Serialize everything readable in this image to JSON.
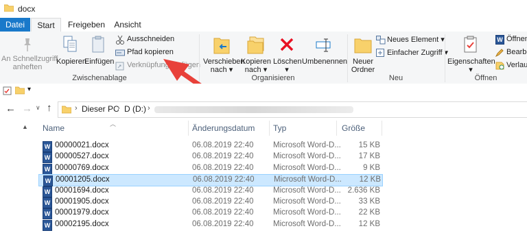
{
  "window": {
    "title": "docx"
  },
  "tabs": [
    "Datei",
    "Start",
    "Freigeben",
    "Ansicht"
  ],
  "ribbon": {
    "clipboard": {
      "pin_label": [
        "An Schnellzugriff",
        "anheften"
      ],
      "copy_label": "Kopieren",
      "paste_label": "Einfügen",
      "cut_label": "Ausschneiden",
      "copy_path_label": "Pfad kopieren",
      "paste_shortcut_label": "Verknüpfung einfügen",
      "group_label": "Zwischenablage"
    },
    "organize": {
      "move_label": [
        "Verschieben",
        "nach ▾"
      ],
      "copyto_label": [
        "Kopieren",
        "nach ▾"
      ],
      "delete_label": [
        "Löschen",
        "▾"
      ],
      "rename_label": "Umbenennen",
      "group_label": "Organisieren"
    },
    "new": {
      "new_folder_label": [
        "Neuer",
        "Ordner"
      ],
      "new_item_label": "Neues Element ▾",
      "easy_access_label": "Einfacher Zugriff ▾",
      "group_label": "Neu"
    },
    "open": {
      "properties_label": [
        "Eigenschaften",
        "▾"
      ],
      "open_label": "Öffnen",
      "edit_label": "Bearbe",
      "history_label": "Verlauf",
      "group_label": "Öffnen"
    }
  },
  "nav": {
    "breadcrumb": [
      "Dieser PC",
      "D (D:)"
    ]
  },
  "columns": {
    "name": "Name",
    "modified": "Änderungsdatum",
    "type": "Typ",
    "size": "Größe"
  },
  "files": [
    {
      "name": "00000021.docx",
      "modified": "06.08.2019 22:40",
      "type": "Microsoft Word-D...",
      "size": "15 KB",
      "selected": false
    },
    {
      "name": "00000527.docx",
      "modified": "06.08.2019 22:40",
      "type": "Microsoft Word-D...",
      "size": "17 KB",
      "selected": false
    },
    {
      "name": "00000769.docx",
      "modified": "06.08.2019 22:40",
      "type": "Microsoft Word-D...",
      "size": "9 KB",
      "selected": false
    },
    {
      "name": "00001205.docx",
      "modified": "06.08.2019 22:40",
      "type": "Microsoft Word-D...",
      "size": "12 KB",
      "selected": true
    },
    {
      "name": "00001694.docx",
      "modified": "06.08.2019 22:40",
      "type": "Microsoft Word-D...",
      "size": "2.636 KB",
      "selected": false
    },
    {
      "name": "00001905.docx",
      "modified": "06.08.2019 22:40",
      "type": "Microsoft Word-D...",
      "size": "33 KB",
      "selected": false
    },
    {
      "name": "00001979.docx",
      "modified": "06.08.2019 22:40",
      "type": "Microsoft Word-D...",
      "size": "22 KB",
      "selected": false
    },
    {
      "name": "00002195.docx",
      "modified": "06.08.2019 22:40",
      "type": "Microsoft Word-D...",
      "size": "12 KB",
      "selected": false
    }
  ],
  "colors": {
    "accent": "#1979ca",
    "selection": "#cce8ff",
    "arrow": "#e8413a",
    "delete_x": "#e81123"
  }
}
